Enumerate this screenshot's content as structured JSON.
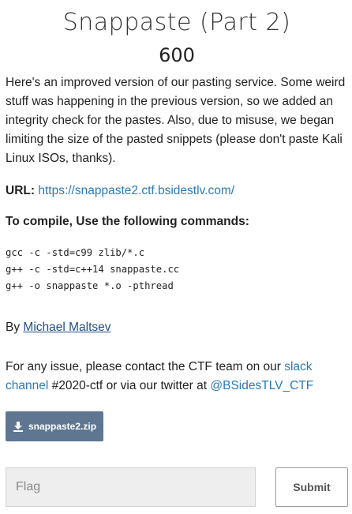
{
  "challenge": {
    "title": "Snappaste (Part 2)",
    "points": "600",
    "description": "Here's an improved version of our pasting service. Some weird stuff was happening in the previous version, so we added an integrity check for the pastes. Also, due to misuse, we began limiting the size of the pasted snippets (please don't paste Kali Linux ISOs, thanks).",
    "url_label": "URL:",
    "url": "https://snappaste2.ctf.bsidestlv.com/",
    "compile_heading": "To compile, Use the following commands:",
    "commands": [
      "gcc -c -std=c99 zlib/*.c",
      "g++ -c -std=c++14 snappaste.cc",
      "g++ -o snappaste *.o -pthread"
    ],
    "author_prefix": "By",
    "author_name": "Michael Maltsev"
  },
  "contact": {
    "prefix": "For any issue, please contact the CTF team on our",
    "slack_link": "slack channel",
    "channel": "#2020-ctf",
    "middle": "or via our twitter at",
    "twitter_link": "@BSidesTLV_CTF"
  },
  "attachment": {
    "icon": "download-icon",
    "label": "snappaste2.zip",
    "color": "#5f7691"
  },
  "flag_form": {
    "placeholder": "Flag",
    "value": "",
    "submit_label": "Submit"
  },
  "colors": {
    "link": "#2a7ab7",
    "author_link": "#1f4f8a",
    "text": "#222222"
  }
}
